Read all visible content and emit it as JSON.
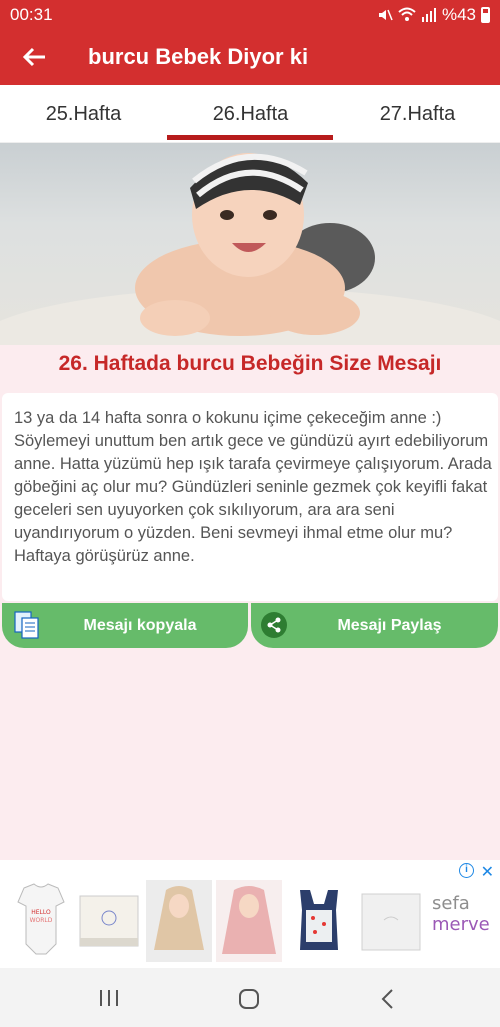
{
  "status": {
    "time": "00:31",
    "battery": "%43"
  },
  "appbar": {
    "title": "burcu  Bebek Diyor ki"
  },
  "tabs": [
    {
      "label": "25.Hafta"
    },
    {
      "label": "26.Hafta",
      "selected": true
    },
    {
      "label": "27.Hafta"
    }
  ],
  "heading": "26. Haftada burcu  Bebeğin Size Mesajı",
  "message": "13 ya da 14 hafta sonra o kokunu içime çekeceğim anne :) Söylemeyi unuttum ben artık gece ve gündüzü ayırt edebiliyorum anne. Hatta yüzümü hep ışık tarafa çevirmeye çalışıyorum. Arada göbeğini aç olur mu? Gündüzleri seninle gezmek çok keyifli fakat geceleri sen uyuyorken çok sıkılıyorum, ara ara seni uyandırıyorum o yüzden. Beni sevmeyi ihmal etme olur mu? Haftaya görüşürüz anne.",
  "buttons": {
    "copy": "Mesajı kopyala",
    "share": "Mesajı Paylaş"
  },
  "ad": {
    "brand_line1": "sefa",
    "brand_line2": "merve"
  },
  "colors": {
    "primary": "#d32f2f",
    "accent": "#b71c1c",
    "button": "#66bb6a",
    "background": "#fcecef"
  }
}
